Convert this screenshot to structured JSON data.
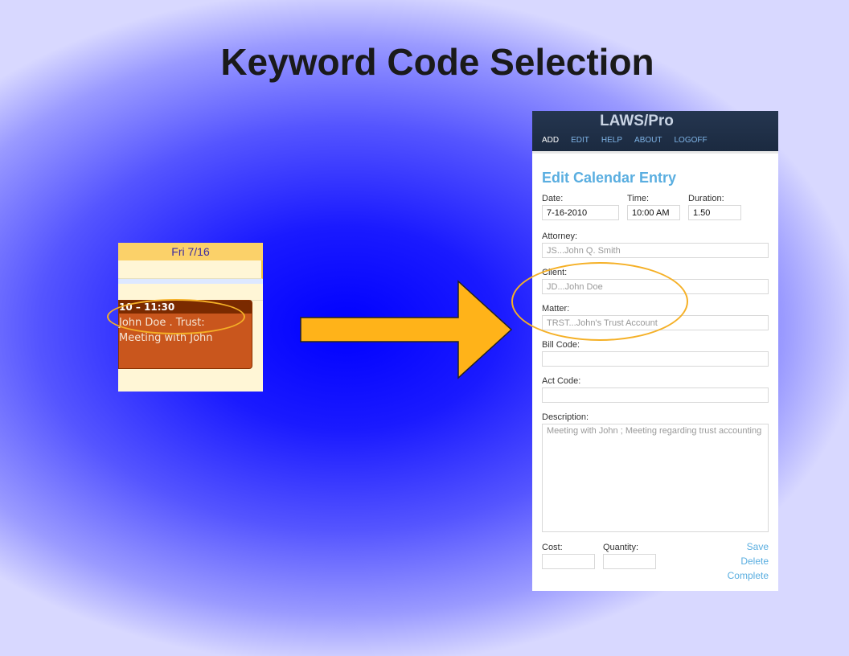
{
  "slide": {
    "title": "Keyword Code Selection"
  },
  "calendar": {
    "day_header": "Fri 7/16",
    "event": {
      "time": "10 – 11:30",
      "line1": "John Doe . Trust:",
      "line2": "Meeting with John"
    }
  },
  "app": {
    "title": "LAWS/Pro",
    "nav": [
      "ADD",
      "EDIT",
      "HELP",
      "ABOUT",
      "LOGOFF"
    ],
    "form_title": "Edit Calendar Entry",
    "fields": {
      "date": {
        "label": "Date:",
        "value": "7-16-2010"
      },
      "time": {
        "label": "Time:",
        "value": "10:00 AM"
      },
      "duration": {
        "label": "Duration:",
        "value": "1.50"
      },
      "attorney": {
        "label": "Attorney:",
        "value": "JS...John Q. Smith"
      },
      "client": {
        "label": "Client:",
        "value": "JD...John Doe"
      },
      "matter": {
        "label": "Matter:",
        "value": "TRST...John's Trust Account"
      },
      "bill_code": {
        "label": "Bill Code:",
        "value": ""
      },
      "act_code": {
        "label": "Act Code:",
        "value": ""
      },
      "description": {
        "label": "Description:",
        "value": "Meeting with John ; Meeting regarding trust accounting"
      },
      "cost": {
        "label": "Cost:",
        "value": ""
      },
      "quantity": {
        "label": "Quantity:",
        "value": ""
      }
    },
    "actions": [
      "Save",
      "Delete",
      "Complete"
    ]
  },
  "colors": {
    "accent": "#5aaee0",
    "highlight": "#f5b026",
    "event": "#c9561d"
  }
}
